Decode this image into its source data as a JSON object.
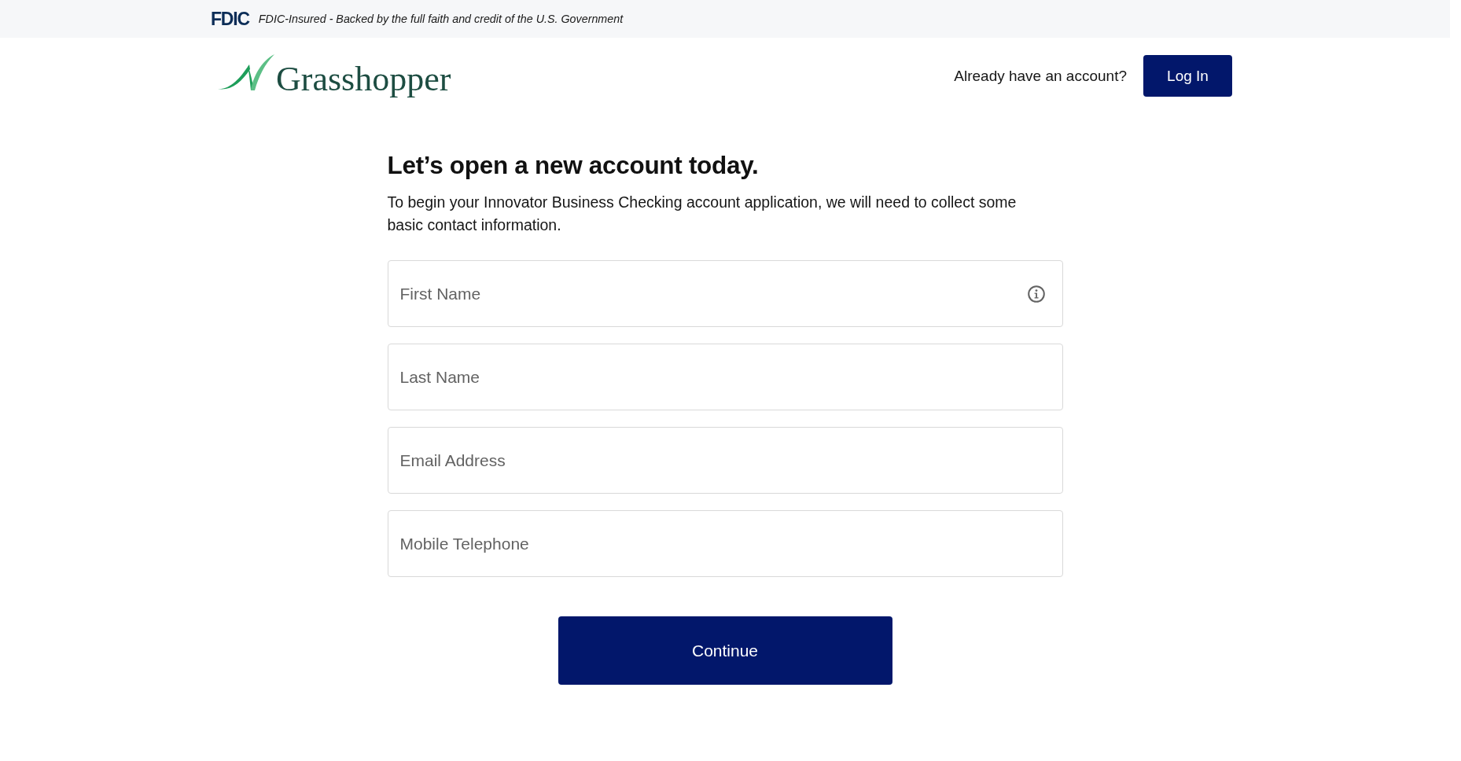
{
  "top_banner": {
    "logo": "FDIC",
    "notice": "FDIC-Insured - Backed by the full faith and credit of the U.S. Government"
  },
  "header": {
    "brand": "Grasshopper",
    "prompt": "Already have an account?",
    "login_button": "Log In"
  },
  "form": {
    "title": "Let’s open a new account today.",
    "intro": "To begin your Innovator Business Checking account application, we will need to collect some basic contact information.",
    "fields": [
      {
        "placeholder": "First Name",
        "info": true
      },
      {
        "placeholder": "Last Name",
        "info": false
      },
      {
        "placeholder": "Email Address",
        "info": false
      },
      {
        "placeholder": "Mobile Telephone",
        "info": false
      }
    ],
    "submit_button": "Continue"
  }
}
